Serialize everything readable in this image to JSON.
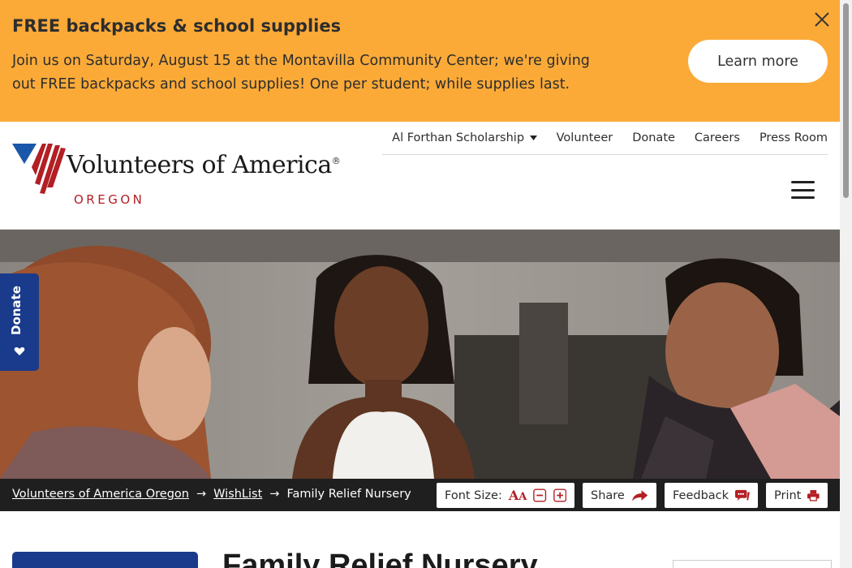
{
  "alert": {
    "title": "FREE backpacks & school supplies",
    "text": "Join us on Saturday, August 15 at the Montavilla Community Center; we're giving out FREE backpacks and school supplies! One per student; while supplies last.",
    "button_label": "Learn more",
    "close_icon": "close-icon",
    "background_color": "#fbaa38"
  },
  "header": {
    "logo_text": "Volunteers of America",
    "logo_registered": "®",
    "logo_sub": "OREGON",
    "utility_nav": [
      {
        "label": "Al Forthan Scholarship",
        "has_dropdown": true
      },
      {
        "label": "Volunteer"
      },
      {
        "label": "Donate"
      },
      {
        "label": "Careers"
      },
      {
        "label": "Press Room"
      }
    ],
    "menu_icon": "hamburger-icon"
  },
  "donate_tab": {
    "label": "Donate",
    "icon": "heart-icon",
    "color": "#1a3b8b"
  },
  "breadcrumb": {
    "items": [
      "Volunteers of America Oregon",
      "WishList",
      "Family Relief Nursery"
    ],
    "separator": "→"
  },
  "tools": {
    "font_size_label": "Font Size:",
    "share_label": "Share",
    "feedback_label": "Feedback",
    "print_label": "Print"
  },
  "page": {
    "title": "Family Relief Nursery"
  },
  "colors": {
    "brand_blue": "#1a3b8b",
    "brand_red": "#b21f24",
    "accent_orange": "#fbaa38"
  }
}
